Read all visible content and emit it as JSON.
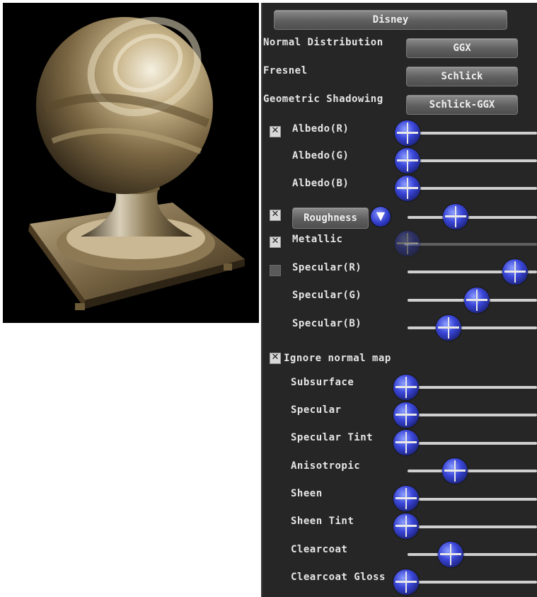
{
  "shading_model": "Disney",
  "normal_distribution": {
    "label": "Normal Distribution",
    "value": "GGX"
  },
  "fresnel": {
    "label": "Fresnel",
    "value": "Schlick"
  },
  "geometric_shadowing": {
    "label": "Geometric Shadowing",
    "value": "Schlick-GGX"
  },
  "albedo_r": {
    "label": "Albedo(R)",
    "checked": true,
    "value": 0.0
  },
  "albedo_g": {
    "label": "Albedo(G)",
    "value": 0.0
  },
  "albedo_b": {
    "label": "Albedo(B)",
    "value": 0.0
  },
  "roughness": {
    "label": "Roughness",
    "checked": true,
    "value": 0.35
  },
  "metallic": {
    "label": "Metallic",
    "checked": true,
    "value": 0.0
  },
  "specular_r": {
    "label": "Specular(R)",
    "checked": false,
    "value": 0.88
  },
  "specular_g": {
    "label": "Specular(G)",
    "value": 0.55
  },
  "specular_b": {
    "label": "Specular(B)",
    "value": 0.32
  },
  "ignore_normal_map": {
    "label": "Ignore normal map",
    "checked": true
  },
  "disney_params": [
    {
      "label": "Subsurface",
      "value": 0.0
    },
    {
      "label": "Specular",
      "value": 0.0
    },
    {
      "label": "Specular Tint",
      "value": 0.0
    },
    {
      "label": "Anisotropic",
      "value": 0.37
    },
    {
      "label": "Sheen",
      "value": 0.0
    },
    {
      "label": "Sheen Tint",
      "value": 0.0
    },
    {
      "label": "Clearcoat",
      "value": 0.35
    },
    {
      "label": "Clearcoat Gloss",
      "value": 0.0
    }
  ],
  "colors": {
    "panel": "#262626",
    "knob": "#3a46d8",
    "material": "#8a7a5c"
  }
}
